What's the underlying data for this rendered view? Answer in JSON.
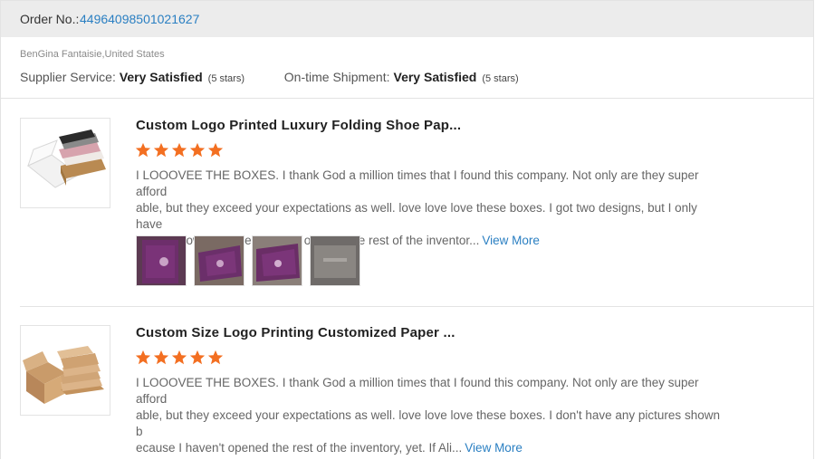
{
  "order": {
    "label": "Order No.:",
    "number": "44964098501021627"
  },
  "buyer": {
    "name_country": "BenGina Fantaisie,United States"
  },
  "supplier_ratings": {
    "service_label": "Supplier Service:",
    "service_value": "Very Satisfied",
    "service_stars": "(5 stars)",
    "shipment_label": "On-time Shipment:",
    "shipment_value": "Very Satisfied",
    "shipment_stars": "(5 stars)"
  },
  "reviews": [
    {
      "title": "Custom Logo Printed Luxury Folding Shoe Pap...",
      "rating": 5,
      "text_lines": [
        "I LOOOVEE THE BOXES. I thank God a million times that I found this company. Not only are they super afford",
        "able, but they exceed your expectations as well. love love love these boxes. I got two designs, but I only have",
        "one to show because I haven't opened the rest of the inventor..."
      ],
      "view_more": "View More",
      "photo_count": 4
    },
    {
      "title": "Custom Size Logo Printing Customized Paper ...",
      "rating": 5,
      "text_lines": [
        "I LOOOVEE THE BOXES. I thank God a million times that I found this company. Not only are they super afford",
        "able, but they exceed your expectations as well. love love love these boxes. I don't have any pictures shown b",
        "ecause I haven't opened the rest of the inventory, yet. If Ali..."
      ],
      "view_more": "View More",
      "photo_count": 0
    }
  ],
  "colors": {
    "link": "#2a7fc2",
    "star": "#f36f21",
    "order_bar_bg": "#ececec"
  }
}
